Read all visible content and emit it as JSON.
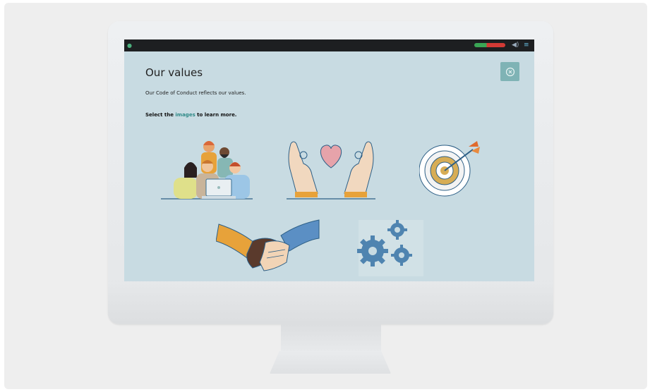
{
  "lesson": {
    "title": "Our values",
    "intro": "Our Code of Conduct reflects our values.",
    "prompt_before": "Select the",
    "prompt_highlight": "images",
    "prompt_after": "to learn more."
  },
  "toolbar": {
    "close_icon": "close-circle-icon",
    "volume_icon": "speaker-icon",
    "menu_icon": "menu-icon",
    "progress_icon": "progress-pill-icon"
  },
  "value_images": [
    {
      "icon": "team-people-icon"
    },
    {
      "icon": "hands-heart-icon"
    },
    {
      "icon": "target-arrow-icon"
    },
    {
      "icon": "handshake-icon"
    },
    {
      "icon": "gears-icon"
    }
  ],
  "colors": {
    "screen_bg": "#c8dbe2",
    "accent_teal": "#7fb3b5",
    "highlight": "#2f8a87"
  }
}
